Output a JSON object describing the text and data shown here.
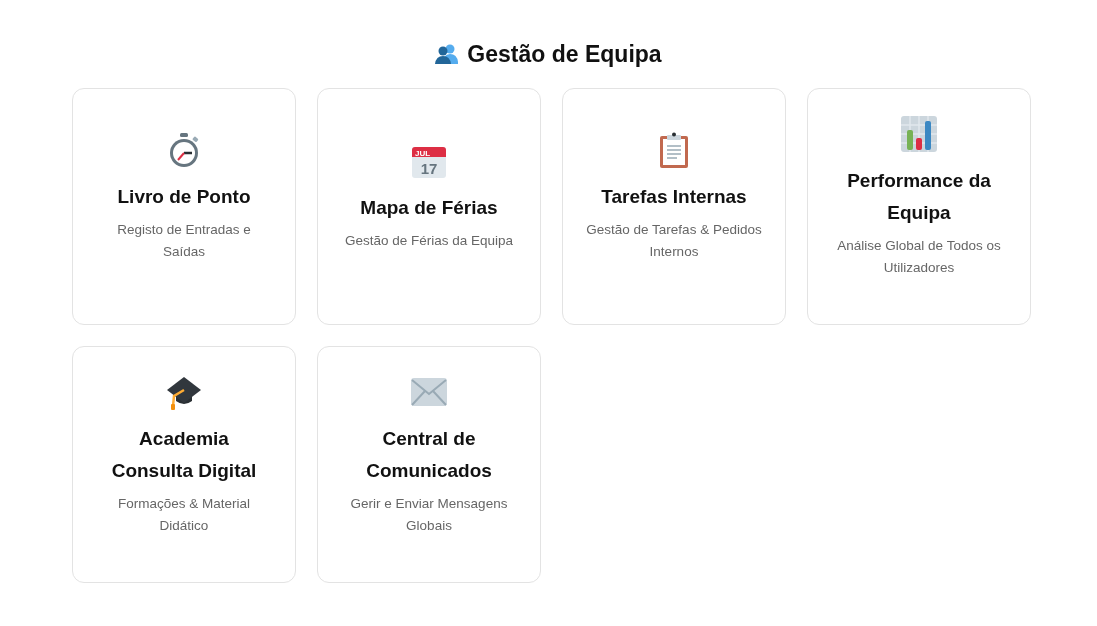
{
  "header": {
    "title": "Gestão de Equipa"
  },
  "cards": [
    {
      "kind": "stopwatch",
      "title": "Livro de Ponto",
      "description": "Registo de Entradas e Saídas"
    },
    {
      "kind": "calendar",
      "icon_month": "JUL",
      "icon_day": "17",
      "title": "Mapa de Férias",
      "description": "Gestão de Férias da Equipa"
    },
    {
      "kind": "clipboard",
      "title": "Tarefas Internas",
      "description": "Gestão de Tarefas & Pedidos Internos"
    },
    {
      "kind": "chart",
      "title": "Performance da Equipa",
      "description": "Análise Global de Todos os Utilizadores"
    },
    {
      "kind": "cap",
      "title": "Academia Consulta Digital",
      "description": "Formações & Material Didático"
    },
    {
      "kind": "envelope",
      "title": "Central de Comunicados",
      "description": "Gerir e Enviar Mensagens Globais"
    }
  ]
}
